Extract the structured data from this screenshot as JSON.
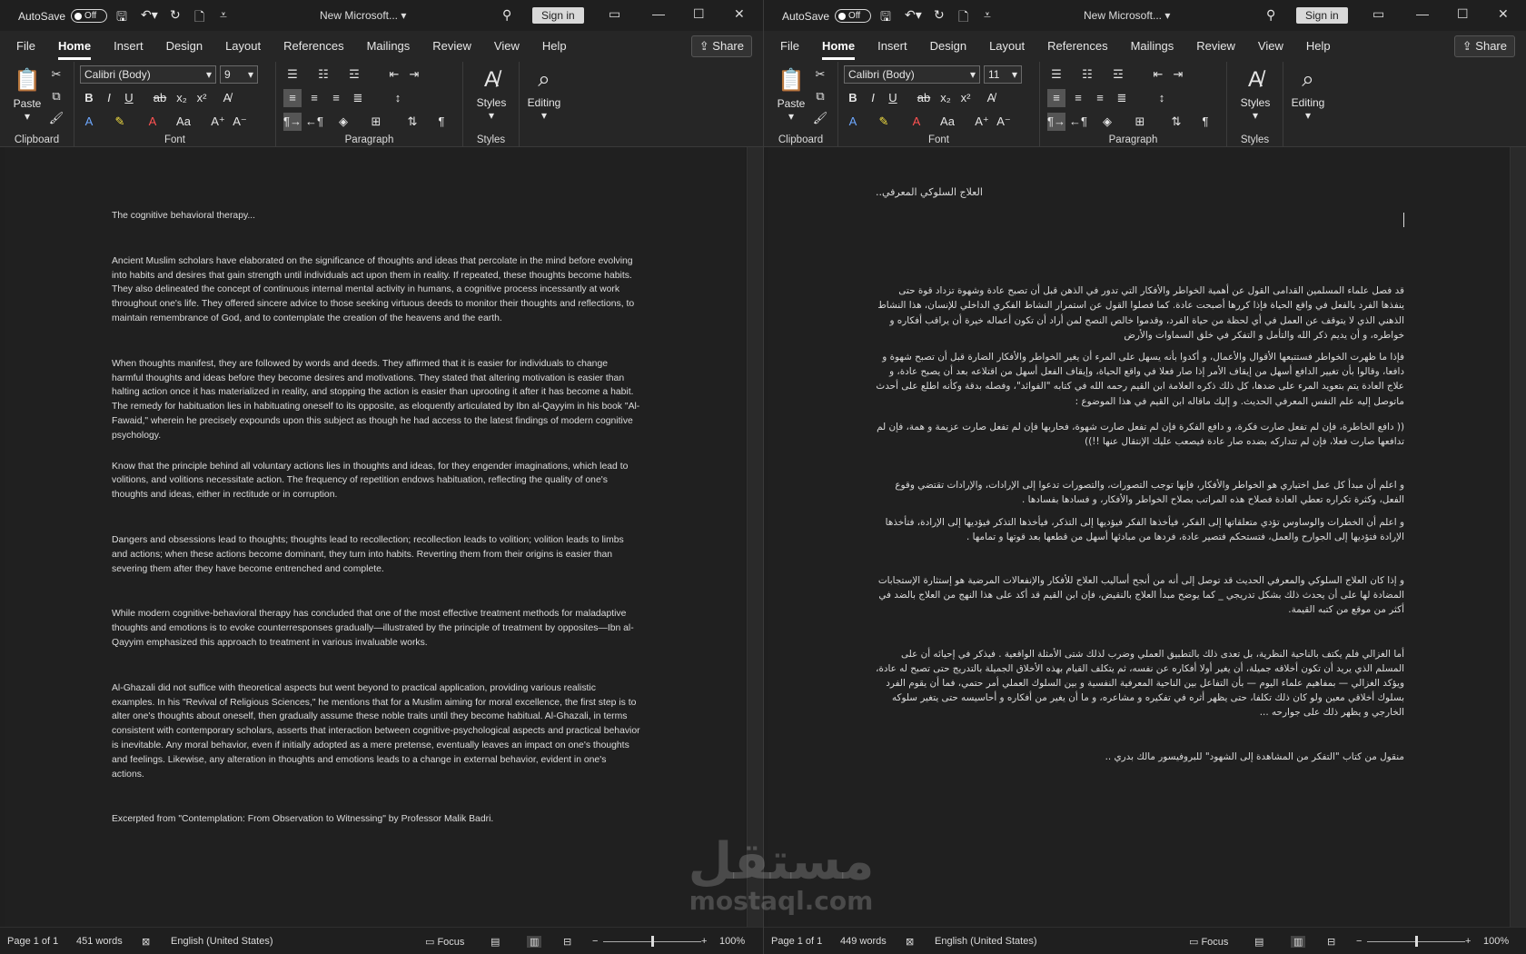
{
  "left": {
    "autosave_label": "AutoSave",
    "toggle_label": "Off",
    "title": "New Microsoft...",
    "signin": "Sign in",
    "menu": [
      "File",
      "Home",
      "Insert",
      "Design",
      "Layout",
      "References",
      "Mailings",
      "Review",
      "View",
      "Help"
    ],
    "share": "Share",
    "font_name": "Calibri (Body)",
    "font_size": "9",
    "groups": {
      "clipboard": "Clipboard",
      "font": "Font",
      "paragraph": "Paragraph",
      "styles": "Styles"
    },
    "paste": "Paste",
    "styles_btn": "Styles",
    "editing_btn": "Editing",
    "doc": {
      "title": "The cognitive behavioral therapy...",
      "p1": "Ancient Muslim scholars have elaborated on the significance of thoughts and ideas that percolate in the mind before evolving into habits and desires that gain strength until individuals act upon them in reality. If repeated, these thoughts become habits. They also delineated the concept of continuous internal mental activity in humans, a cognitive process incessantly at work throughout one's life. They offered sincere advice to those seeking virtuous deeds to monitor their thoughts and reflections, to maintain remembrance of God, and to contemplate the creation of the heavens and the earth.",
      "p2": "When thoughts manifest, they are followed by words and deeds. They affirmed that it is easier for individuals to change harmful thoughts and ideas before they become desires and motivations. They stated that altering motivation is easier than halting action once it has materialized in reality, and stopping the action is easier than uprooting it after it has become a habit. The remedy for habituation lies in habituating oneself to its opposite, as eloquently articulated by Ibn al-Qayyim in his book \"Al-Fawaid,\" wherein he precisely expounds upon this subject as though he had access to the latest findings of modern cognitive psychology.",
      "p3": "Know that the principle behind all voluntary actions lies in thoughts and ideas, for they engender imaginations, which lead to volitions, and volitions necessitate action. The frequency of repetition endows habituation, reflecting the quality of one's thoughts and ideas, either in rectitude or in corruption.",
      "p4": "Dangers and obsessions lead to thoughts; thoughts lead to recollection; recollection leads to volition; volition leads to limbs and actions; when these actions become dominant, they turn into habits. Reverting them from their origins is easier than severing them after they have become entrenched and complete.",
      "p5": "While modern cognitive-behavioral therapy has concluded that one of the most effective treatment methods for maladaptive thoughts and emotions is to evoke counterresponses gradually—illustrated by the principle of treatment by opposites—Ibn al-Qayyim emphasized this approach to treatment in various invaluable works.",
      "p6": "Al-Ghazali did not suffice with theoretical aspects but went beyond to practical application, providing various realistic examples. In his \"Revival of Religious Sciences,\" he mentions that for a Muslim aiming for moral excellence, the first step is to alter one's thoughts about oneself, then gradually assume these noble traits until they become habitual. Al-Ghazali, in terms consistent with contemporary scholars, asserts that interaction between cognitive-psychological aspects and practical behavior is inevitable. Any moral behavior, even if initially adopted as a mere pretense, eventually leaves an impact on one's thoughts and feelings. Likewise, any alteration in thoughts and emotions leads to a change in external behavior, evident in one's actions.",
      "p7": "Excerpted from \"Contemplation: From Observation to Witnessing\" by Professor Malik Badri."
    },
    "status": {
      "page": "Page 1 of 1",
      "words": "451 words",
      "lang": "English (United States)",
      "focus": "Focus",
      "zoom": "100%"
    }
  },
  "right": {
    "autosave_label": "AutoSave",
    "toggle_label": "Off",
    "title": "New Microsoft...",
    "signin": "Sign in",
    "menu": [
      "File",
      "Home",
      "Insert",
      "Design",
      "Layout",
      "References",
      "Mailings",
      "Review",
      "View",
      "Help"
    ],
    "share": "Share",
    "font_name": "Calibri (Body)",
    "font_size": "11",
    "groups": {
      "clipboard": "Clipboard",
      "font": "Font",
      "paragraph": "Paragraph",
      "styles": "Styles"
    },
    "paste": "Paste",
    "styles_btn": "Styles",
    "editing_btn": "Editing",
    "doc": {
      "title": "العلاج السلوكي المعرفي..",
      "p1": "قد فصل علماء المسلمين القدامى القول عن أهمية الخواطر والأفكار التي تدور في الذهن قبل أن تصبح عادة وشهوة تزداد قوة حتى ينفذها الفرد بالفعل في واقع الحياة فإذا كررها أصبحت عادة. كما فصلوا القول عن استمرار النشاط الفكري الداخلي للإنسان، هذا النشاط الذهني الذي لا يتوقف عن العمل في أي لحظة من حياة الفرد، وقدموا خالص النصح لمن أراد أن تكون أعماله خيرة أن يراقب أفكاره و خواطره، و أن يديم ذكر الله والتأمل و التفكر في خلق السماوات والأرض",
      "p2": "فإذا ما ظهرت الخواطر فستتبعها الأقوال والأعمال، و أكدوا بأنه يسهل على المرء أن يغير الخواطر والأفكار الضارة قبل أن تصبح شهوة و دافعا، وقالوا بأن تغيير الدافع أسهل من إيقاف الأمر إذا صار فعلا في واقع الحياة، وإيقاف الفعل أسهل من اقتلاعه بعد أن يصبح عادة، و علاج العادة يتم بتعويد المرء على ضدها، كل ذلك ذكره العلامة ابن القيم رحمه الله في كتابه \"الفوائد\"، وفصله بدقة وكأنه اطلع على أحدث ماتوصل إليه علم النفس المعرفي الحديث. و إليك ماقاله ابن القيم في هذا الموضوع :",
      "p3": "(( دافع الخاطرة، فإن لم تفعل صارت فكرة، و دافع الفكرة فإن لم تفعل صارت شهوة، فحاربها فإن لم تفعل صارت عزيمة و همة، فإن لم تدافعها صارت فعلا، فإن لم تتداركه بضده صار عادة فيصعب عليك الإنتقال عنها !!))",
      "p4": "و اعلم أن مبدأ كل عمل اختياري هو الخواطر والأفكار، فإنها توجب التصورات، والتصورات تدعوا إلى الإرادات، والإرادات تقتضي وقوع الفعل، وكثرة تكراره تعطي العادة فصلاح هذه المراتب بصلاح الخواطر والأفكار، و فسادها بفسادها .",
      "p5": "و اعلم أن الخطرات والوساوس تؤدي متعلقاتها إلى الفكر، فيأخذها الفكر فيؤديها إلى التذكر، فيأخذها التذكر فيؤديها إلى الإرادة، فتأخذها الإرادة فتؤديها إلى الجوارح والعمل، فتستحكم فتصير عادة، فردها من مبادئها أسهل من قطعها بعد قوتها و تمامها .",
      "p6": "و إذا كان العلاج السلوكي والمعرفي الحديث قد توصل إلى أنه من أنجح أساليب العلاج للأفكار والإنفعالات المرضية هو إستثارة الإستجابات المضادة لها على أن يحدث ذلك بشكل تدريجي _ كما يوضح مبدأ العلاج بالنقيض، فإن ابن القيم قد أكد على هذا النهج من العلاج بالضد في أكثر من موقع من كتبه القيمة.",
      "p7": "أما الغزالي فلم يكتف بالناحية النظرية، بل تعدى ذلك بالتطبيق العملي وضرب لذلك شتى الأمثلة الواقعية . فيذكر في إحيائه أن على المسلم الذي يريد أن تكون أخلاقه جميلة، أن يغير أولا أفكاره عن نفسه، ثم يتكلف القيام بهذه الأخلاق الجميلة بالتدريج حتى تصبح له عادة، ويؤكد الغزالي — بمفاهيم علماء اليوم — بأن التفاعل بين الناحية المعرفية النفسية و بين السلوك العملي أمر حتمي، فما أن يقوم الفرد بسلوك أخلاقي معين ولو كان ذلك تكلفا، حتى يظهر أثره في تفكيره و مشاعره، و ما أن يغير من أفكاره و أحاسيسه حتى يتغير سلوكه الخارجي و يظهر ذلك على جوارحه ...",
      "p8": "منقول من كتاب \"التفكر من المشاهدة إلى الشهود\" للبروفيسور مالك بدري .."
    },
    "status": {
      "page": "Page 1 of 1",
      "words": "449 words",
      "lang": "English (United States)",
      "focus": "Focus",
      "zoom": "100%"
    }
  },
  "watermark": {
    "arabic": "مستقل",
    "latin": "mostaql.com"
  },
  "zoom_level_fraction": 0.5
}
